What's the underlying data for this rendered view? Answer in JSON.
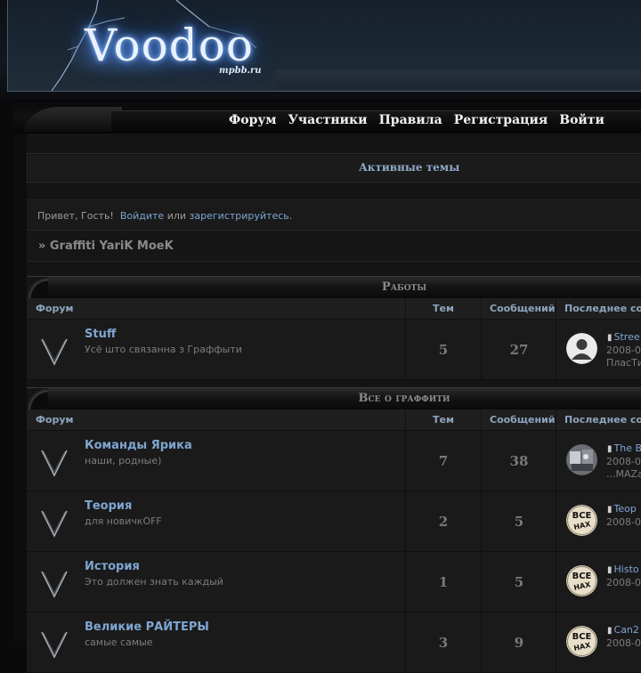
{
  "header": {
    "logo_text": "Voodoo",
    "logo_sub": "mpbb.ru"
  },
  "nav": {
    "items": [
      "Форум",
      "Участники",
      "Правила",
      "Регистрация",
      "Войти"
    ]
  },
  "active_topics": "Активные темы",
  "welcome": {
    "greeting": "Привет, Гость!",
    "login": "Войдите",
    "or": "или",
    "register": "зарегистрируйтесь",
    "end": "."
  },
  "breadcrumb": "» Graffiti YariK MoeK",
  "columns": {
    "forum": "Форум",
    "topics": "Тем",
    "posts": "Сообщений",
    "last_post": "Последнее соо"
  },
  "categories": [
    {
      "title": "Работы",
      "forums": [
        {
          "name": "Stuff",
          "desc": "Усё што связанна з Граффыти",
          "topics": "5",
          "posts": "27",
          "avatar": "default",
          "lp_title": "Stree",
          "lp_date": "2008-0",
          "lp_author": "ПласТи"
        }
      ]
    },
    {
      "title": "Все о граффити",
      "forums": [
        {
          "name": "Команды Ярика",
          "desc": "наши, родные)",
          "topics": "7",
          "posts": "38",
          "avatar": "photo",
          "lp_title": "The B",
          "lp_date": "2008-0",
          "lp_author": "...MAZa"
        },
        {
          "name": "Теория",
          "desc": "для новичкOFF",
          "topics": "2",
          "posts": "5",
          "avatar": "badge",
          "lp_title": "Teop",
          "lp_date": "2008-0",
          "lp_author": ""
        },
        {
          "name": "История",
          "desc": "Это должен знать каждый",
          "topics": "1",
          "posts": "5",
          "avatar": "badge",
          "lp_title": "Histo",
          "lp_date": "2008-0",
          "lp_author": ""
        },
        {
          "name": "Великие РАЙТЕРЫ",
          "desc": "самые самые",
          "topics": "3",
          "posts": "9",
          "avatar": "badge",
          "lp_title": "Can2",
          "lp_date": "2008-0",
          "lp_author": ""
        }
      ]
    }
  ],
  "badge_text": {
    "top": "ВСЕ",
    "bottom": "НАХ"
  },
  "colors": {
    "link": "#7ea6d2",
    "header_blue": "#8ea4be",
    "bg": "#141414"
  }
}
